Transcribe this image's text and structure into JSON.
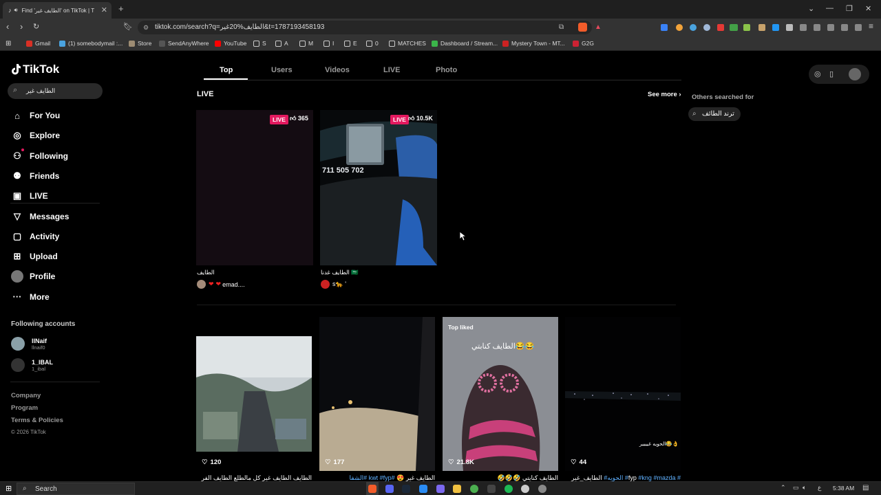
{
  "browser": {
    "tab_title": "Find 'الطايف غير' on TikTok | T",
    "url": "tiktok.com/search?q=الطايف%20غير&t=1787193458193",
    "bookmarks": [
      {
        "label": "Gmail",
        "color": "#d93025"
      },
      {
        "label": "(1) somebodymail :...",
        "color": "#4aa3df"
      },
      {
        "label": "Store",
        "color": "#9d8c73"
      },
      {
        "label": "SendAnyWhere",
        "color": "#555555"
      },
      {
        "label": "YouTube",
        "color": "#ff0000"
      },
      {
        "label": "S",
        "color": "folder"
      },
      {
        "label": "A",
        "color": "folder"
      },
      {
        "label": "M",
        "color": "folder"
      },
      {
        "label": "I",
        "color": "folder"
      },
      {
        "label": "E",
        "color": "folder"
      },
      {
        "label": "0",
        "color": "folder"
      },
      {
        "label": "MATCHES",
        "color": "folder"
      },
      {
        "label": "Dashboard / Stream...",
        "color": "#3bb54a"
      },
      {
        "label": "Mystery Town - MT...",
        "color": "#cc2222"
      },
      {
        "label": "G2G",
        "color": "#cc2233"
      }
    ]
  },
  "tiktok": {
    "logo": "TikTok",
    "search_value": "الطايف غير",
    "nav": [
      {
        "label": "For You",
        "icon": "home-icon"
      },
      {
        "label": "Explore",
        "icon": "compass-icon"
      },
      {
        "label": "Following",
        "icon": "following-icon"
      },
      {
        "label": "Friends",
        "icon": "friends-icon"
      },
      {
        "label": "LIVE",
        "icon": "live-icon"
      },
      {
        "label": "Messages",
        "icon": "messages-icon"
      },
      {
        "label": "Activity",
        "icon": "activity-icon"
      },
      {
        "label": "Upload",
        "icon": "upload-icon"
      },
      {
        "label": "Profile",
        "icon": "profile-avatar"
      },
      {
        "label": "More",
        "icon": "more-icon"
      }
    ],
    "following_header": "Following accounts",
    "accounts": [
      {
        "name": "llNaif",
        "handle": "llnaif0"
      },
      {
        "name": "1_IBAL",
        "handle": "1_ibal"
      }
    ],
    "footer": [
      "Company",
      "Program",
      "Terms & Policies",
      "© 2026 TikTok"
    ]
  },
  "tabs": [
    "Top",
    "Users",
    "Videos",
    "LIVE",
    "Photo"
  ],
  "live_section": {
    "title": "LIVE",
    "see_more": "See more",
    "cards": [
      {
        "badge": "LIVE",
        "likes": "365",
        "caption": "الطايف",
        "user": "emad...."
      },
      {
        "badge": "LIVE",
        "likes": "10.5K",
        "caption": "الطايف غدنا 🇸🇦",
        "user": "s🐆 '",
        "dash_numbers": "711 505 702"
      }
    ]
  },
  "others": {
    "title": "Others searched for",
    "items": [
      "ترند الطائف"
    ]
  },
  "videos": [
    {
      "count": "120",
      "caption": "الطايف الطايف غير كل مالطلع الطايف الفر",
      "top_liked": ""
    },
    {
      "count": "177",
      "caption": "الطايف غير 😍 #kwt #fyp #الشفا",
      "top_liked": ""
    },
    {
      "count": "21.8K",
      "caption": "الطايف كنايتي 🤣🤣🤣",
      "top_liked": "Top liked",
      "overlay": "الطايف كنابتي😂😂"
    },
    {
      "count": "44",
      "caption": "# fyp #kng #mazda# الحويه# الطايف_غير",
      "top_liked": "",
      "overlay": "الحويه غيييير😂👌"
    }
  ],
  "taskbar": {
    "search": "Search",
    "time": "5:38 AM",
    "lang": "ع"
  }
}
